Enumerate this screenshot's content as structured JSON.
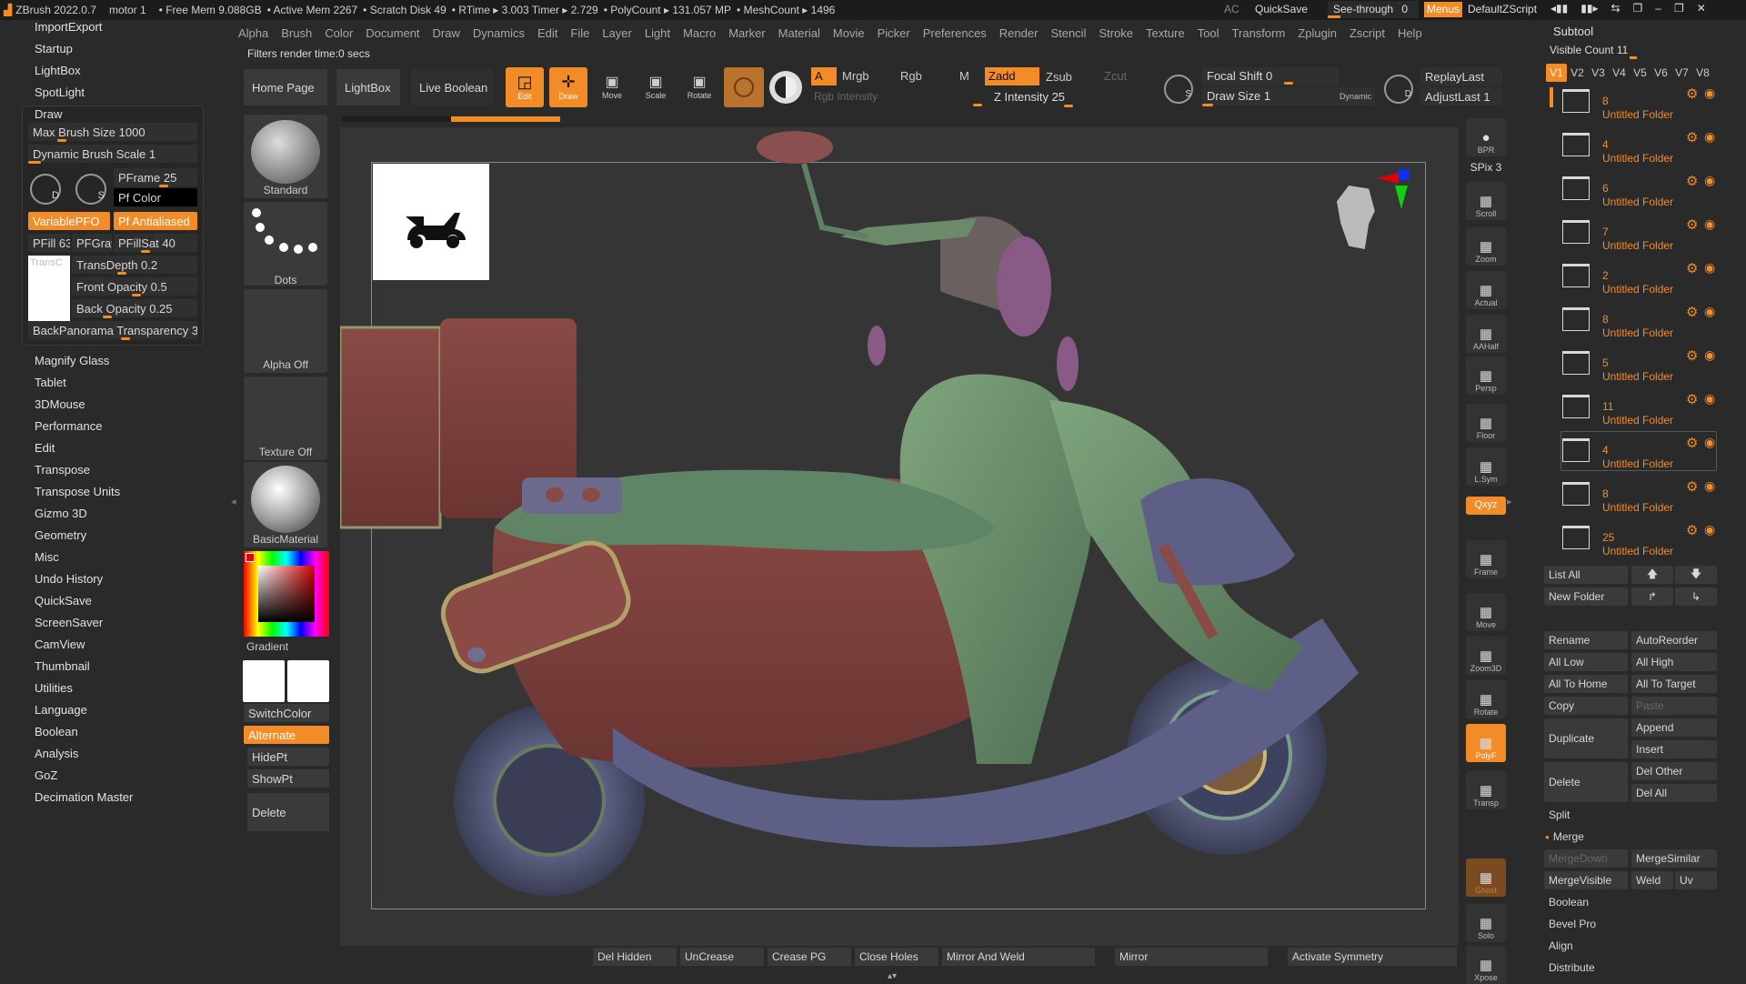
{
  "titlebar": {
    "app": "ZBrush 2022.0.7",
    "doc": "motor 1",
    "free_mem": "• Free Mem 9.088GB",
    "active_mem": "• Active Mem 2267",
    "scratch": "• Scratch Disk 49",
    "rtime": "• RTime ▸ 3.003 Timer ▸ 2.729",
    "polycount": "• PolyCount ▸ 131.057 MP",
    "meshcount": "• MeshCount ▸ 1496",
    "ac": "AC",
    "quicksave": "QuickSave",
    "see_through": "See-through",
    "see_through_value": "0",
    "menus": "Menus",
    "script": "DefaultZScript"
  },
  "menubar": [
    "Alpha",
    "Brush",
    "Color",
    "Document",
    "Draw",
    "Dynamics",
    "Edit",
    "File",
    "Layer",
    "Light",
    "Macro",
    "Marker",
    "Material",
    "Movie",
    "Picker",
    "Preferences",
    "Render",
    "Stencil",
    "Stroke",
    "Texture",
    "Tool",
    "Transform",
    "Zplugin",
    "Zscript",
    "Help"
  ],
  "status_text": "Filters render time:0 secs",
  "left_top_items": [
    "ImportExport",
    "Startup",
    "LightBox",
    "SpotLight"
  ],
  "draw_panel": {
    "title": "Draw",
    "max_brush_size": "Max Brush Size 1000",
    "dynamic_brush_scale": "Dynamic Brush Scale 1",
    "pframe": "PFrame 25",
    "pf_color": "Pf Color",
    "variable_pfo": "VariablePFO",
    "pf_antialiased": "Pf Antialiased",
    "pfill": "PFill 63",
    "pfgray": "PFGray",
    "pfillsat": "PFillSat 40",
    "transc": "TransC",
    "transdepth": "TransDepth 0.2",
    "front_opacity": "Front Opacity 0.5",
    "back_opacity": "Back Opacity 0.25",
    "backpanorama": "BackPanorama Transparency 3",
    "d_label": "D",
    "s_label": "S"
  },
  "left_menu": [
    "Magnify Glass",
    "Tablet",
    "3DMouse",
    "Performance",
    "Edit",
    "Transpose",
    "Transpose Units",
    "Gizmo 3D",
    "Geometry",
    "Misc",
    "Undo History",
    "QuickSave",
    "ScreenSaver",
    "CamView",
    "Thumbnail",
    "Utilities",
    "Language",
    "Boolean",
    "Analysis",
    "GoZ",
    "Decimation Master"
  ],
  "toolbar": {
    "home_page": "Home Page",
    "lightbox": "LightBox",
    "live_boolean": "Live Boolean",
    "edit": "Edit",
    "draw": "Draw",
    "move": "Move",
    "scale": "Scale",
    "rotate": "Rotate",
    "a": "A",
    "mrgb": "Mrgb",
    "rgb": "Rgb",
    "m": "M",
    "zadd": "Zadd",
    "zsub": "Zsub",
    "zcut": "Zcut",
    "rgb_intensity": "Rgb Intensity",
    "z_intensity": "Z Intensity 25",
    "focal_shift": "Focal Shift 0",
    "draw_size": "Draw Size 1",
    "dynamic": "Dynamic",
    "replay_last": "ReplayLast",
    "adjust_last": "AdjustLast 1"
  },
  "shelf": {
    "standard": "Standard",
    "dots": "Dots",
    "alpha_off": "Alpha Off",
    "texture_off": "Texture Off",
    "basic_material": "BasicMaterial",
    "gradient": "Gradient",
    "switch_color": "SwitchColor",
    "alternate": "Alternate",
    "hide_pt": "HidePt",
    "show_pt": "ShowPt",
    "delete": "Delete"
  },
  "right_shelf": [
    {
      "name": "bpr",
      "label": "BPR"
    },
    {
      "name": "spix",
      "label": "SPix 3"
    },
    {
      "name": "scroll",
      "label": "Scroll"
    },
    {
      "name": "zoom",
      "label": "Zoom"
    },
    {
      "name": "actual",
      "label": "Actual"
    },
    {
      "name": "aahalf",
      "label": "AAHalf"
    },
    {
      "name": "persp",
      "label": "Persp"
    },
    {
      "name": "floor",
      "label": "Floor"
    },
    {
      "name": "lsym",
      "label": "L.Sym"
    },
    {
      "name": "xyz",
      "label": "Qxyz"
    },
    {
      "name": "frame",
      "label": "Frame"
    },
    {
      "name": "move",
      "label": "Move"
    },
    {
      "name": "zoom3d",
      "label": "Zoom3D"
    },
    {
      "name": "rotate",
      "label": "Rotate"
    },
    {
      "name": "polyf",
      "label": "PolyF"
    },
    {
      "name": "transp",
      "label": "Transp"
    },
    {
      "name": "ghost",
      "label": "Ghost"
    },
    {
      "name": "solo",
      "label": "Solo"
    },
    {
      "name": "xpose",
      "label": "Xpose"
    }
  ],
  "subtool": {
    "title": "Subtool",
    "visible_count": "Visible Count 11",
    "versions": [
      "V1",
      "V2",
      "V3",
      "V4",
      "V5",
      "V6",
      "V7",
      "V8"
    ],
    "folders": [
      {
        "num": "8",
        "name": "Untitled Folder"
      },
      {
        "num": "4",
        "name": "Untitled Folder"
      },
      {
        "num": "6",
        "name": "Untitled Folder"
      },
      {
        "num": "7",
        "name": "Untitled Folder"
      },
      {
        "num": "2",
        "name": "Untitled Folder"
      },
      {
        "num": "8",
        "name": "Untitled Folder"
      },
      {
        "num": "5",
        "name": "Untitled Folder"
      },
      {
        "num": "11",
        "name": "Untitled Folder"
      },
      {
        "num": "4",
        "name": "Untitled Folder"
      },
      {
        "num": "8",
        "name": "Untitled Folder"
      },
      {
        "num": "25",
        "name": "Untitled Folder"
      }
    ],
    "list_all": "List All",
    "new_folder": "New Folder",
    "rename": "Rename",
    "autoreorder": "AutoReorder",
    "all_low": "All Low",
    "all_high": "All High",
    "all_to_home": "All To Home",
    "all_to_target": "All To Target",
    "copy": "Copy",
    "paste": "Paste",
    "duplicate": "Duplicate",
    "append": "Append",
    "insert": "Insert",
    "delete": "Delete",
    "del_other": "Del Other",
    "del_all": "Del All",
    "split": "Split",
    "merge": "Merge",
    "merge_down": "MergeDown",
    "merge_similar": "MergeSimilar",
    "merge_visible": "MergeVisible",
    "weld": "Weld",
    "uv": "Uv",
    "boolean": "Boolean",
    "bevel_pro": "Bevel Pro",
    "align": "Align",
    "distribute": "Distribute"
  },
  "bottom": {
    "del_hidden": "Del Hidden",
    "uncrease": "UnCrease",
    "crease_pg": "Crease PG",
    "close_holes": "Close Holes",
    "mirror_and_weld": "Mirror And Weld",
    "mirror": "Mirror",
    "activate_symmetry": "Activate Symmetry"
  },
  "colors": {
    "accent": "#f28c28",
    "panel": "#2a2a2a",
    "button": "#3a3a3a",
    "viewport": "#333333"
  }
}
